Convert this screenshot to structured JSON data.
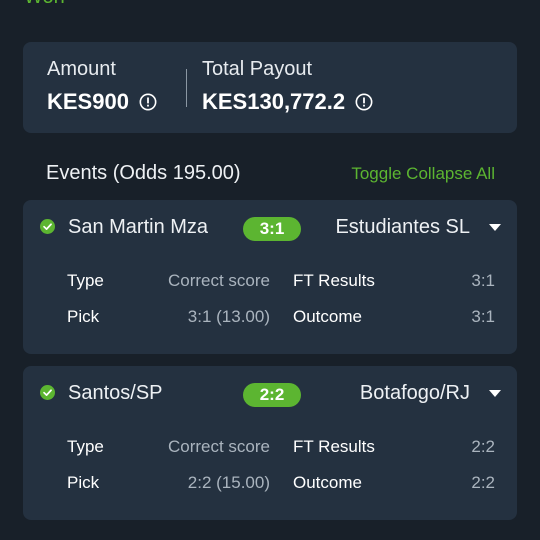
{
  "status": "Won",
  "summary": {
    "amount_label": "Amount",
    "amount_value": "KES900",
    "payout_label": "Total Payout",
    "payout_value": "KES130,772.2"
  },
  "events_title": "Events (Odds 195.00)",
  "toggle_all": "Toggle Collapse All",
  "colors": {
    "accent": "#5cb531",
    "card": "#243140",
    "background": "#182029"
  },
  "events": [
    {
      "home": "San Martin Mza",
      "score": "3:1",
      "away": "Estudiantes SL",
      "type_label": "Type",
      "type_value": "Correct score",
      "ft_label": "FT Results",
      "ft_value": "3:1",
      "pick_label": "Pick",
      "pick_value": "3:1 (13.00)",
      "outcome_label": "Outcome",
      "outcome_value": "3:1"
    },
    {
      "home": "Santos/SP",
      "score": "2:2",
      "away": "Botafogo/RJ",
      "type_label": "Type",
      "type_value": "Correct score",
      "ft_label": "FT Results",
      "ft_value": "2:2",
      "pick_label": "Pick",
      "pick_value": "2:2 (15.00)",
      "outcome_label": "Outcome",
      "outcome_value": "2:2"
    }
  ]
}
